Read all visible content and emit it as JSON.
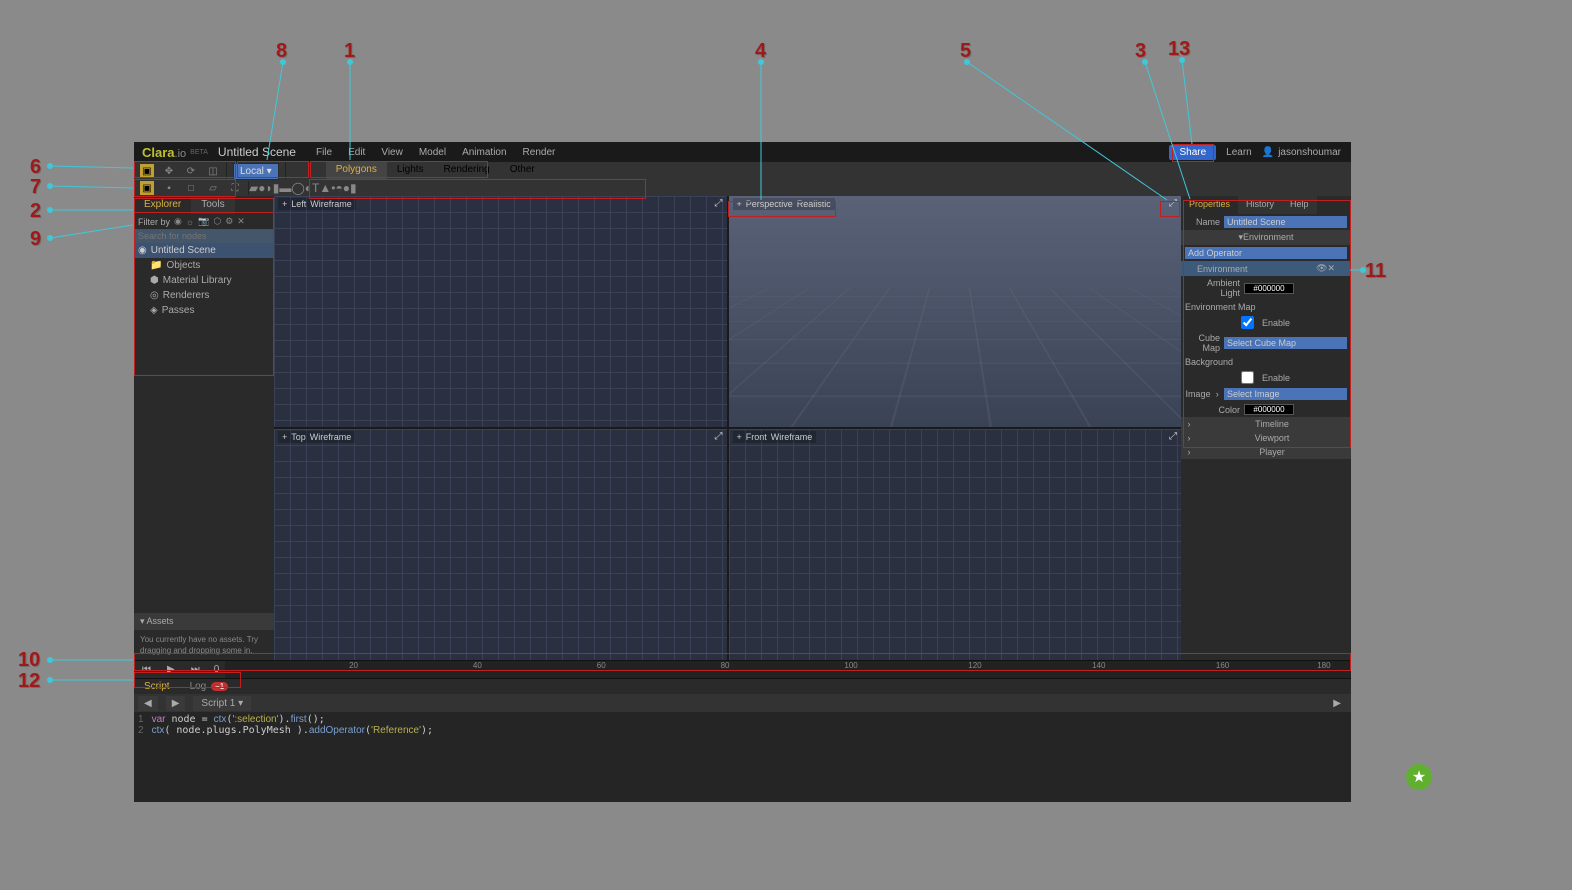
{
  "logo": {
    "main": "Clara",
    "ext": ".io",
    "tag": "BETA"
  },
  "scene_title": "Untitled Scene",
  "menus": [
    "File",
    "Edit",
    "View",
    "Model",
    "Animation",
    "Render"
  ],
  "share_label": "Share",
  "learn_label": "Learn",
  "username": "jasonshoumar",
  "space_selector": "Local",
  "object_tabs": [
    "Polygons",
    "Lights",
    "Rendering",
    "Other"
  ],
  "left_panel": {
    "tabs": [
      "Explorer",
      "Tools"
    ],
    "filter_label": "Filter by",
    "search_placeholder": "Search for nodes",
    "root": "Untitled Scene",
    "nodes": [
      "Objects",
      "Material Library",
      "Renderers",
      "Passes"
    ],
    "assets_label": "Assets",
    "assets_empty": "You currently have no assets. Try dragging and dropping some in."
  },
  "viewports": [
    {
      "name": "Left",
      "mode": "Wireframe"
    },
    {
      "name": "Perspective",
      "mode": "Realistic"
    },
    {
      "name": "Top",
      "mode": "Wireframe"
    },
    {
      "name": "Front",
      "mode": "Wireframe"
    }
  ],
  "right_panel": {
    "tabs": [
      "Properties",
      "History",
      "Help"
    ],
    "name_label": "Name",
    "name_value": "Untitled Scene",
    "env_section": "Environment",
    "add_operator": "Add Operator",
    "env_sub": "Environment",
    "ambient_label": "Ambient Light",
    "ambient_value": "#000000",
    "envmap_label": "Environment Map",
    "enable_label": "Enable",
    "cubemap_label": "Cube Map",
    "cubemap_value": "Select Cube Map",
    "background_label": "Background",
    "image_label": "Image",
    "image_value": "Select Image",
    "color_label": "Color",
    "color_value": "#000000",
    "sections": [
      "Timeline",
      "Viewport",
      "Player"
    ]
  },
  "timeline": {
    "current_frame": "0",
    "ticks": [
      "20",
      "40",
      "60",
      "80",
      "100",
      "120",
      "140",
      "160",
      "180"
    ]
  },
  "bottom": {
    "tabs": [
      "Script",
      "Log"
    ],
    "log_count": "−1",
    "script_name": "Script 1",
    "code_line1": "var node = ctx(':selection').first();",
    "code_line2": "ctx( node.plugs.PolyMesh ).addOperator('Reference');"
  },
  "callouts": {
    "c1": "1",
    "c2": "2",
    "c3": "3",
    "c4": "4",
    "c5": "5",
    "c6": "6",
    "c7": "7",
    "c8": "8",
    "c9": "9",
    "c10": "10",
    "c11": "11",
    "c12": "12",
    "c13": "13"
  }
}
